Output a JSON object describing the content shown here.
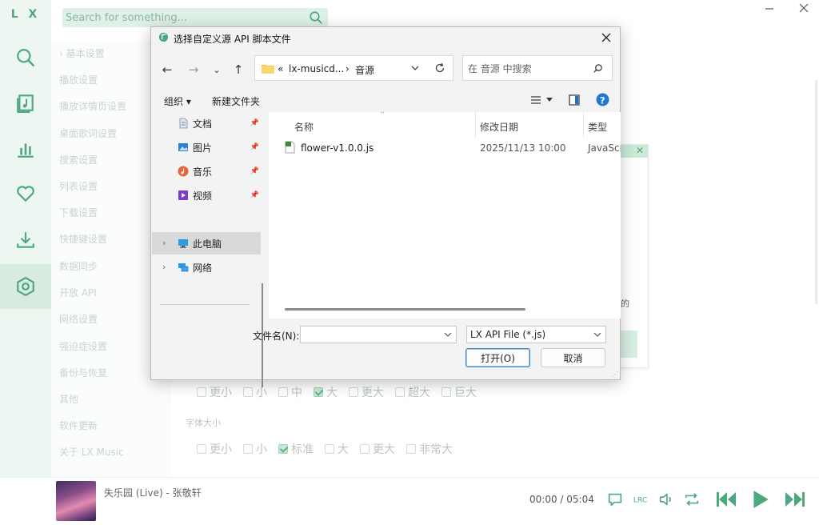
{
  "app": {
    "logo": "L X",
    "search_placeholder": "Search for something...",
    "accent": "#4ca87e"
  },
  "rail_icons": [
    "search-icon",
    "music-library-icon",
    "chart-icon",
    "heart-icon",
    "download-icon",
    "settings-icon"
  ],
  "settings_nav": [
    "› 基本设置",
    "播放设置",
    "播放详情页设置",
    "桌面歌词设置",
    "搜索设置",
    "列表设置",
    "下载设置",
    "快捷键设置",
    "数据同步",
    "开放 API",
    "网络设置",
    "强迫症设置",
    "备份与恢复",
    "其他",
    "软件更新",
    "关于 LX Music"
  ],
  "options_row1": [
    {
      "label": "更小",
      "checked": false
    },
    {
      "label": "小",
      "checked": false
    },
    {
      "label": "中",
      "checked": false
    },
    {
      "label": "大",
      "checked": true
    },
    {
      "label": "更大",
      "checked": false
    },
    {
      "label": "超大",
      "checked": false
    },
    {
      "label": "巨大",
      "checked": false
    }
  ],
  "font_size_label": "字体大小",
  "options_row2": [
    {
      "label": "更小",
      "checked": false
    },
    {
      "label": "小",
      "checked": false
    },
    {
      "label": "标准",
      "checked": true
    },
    {
      "label": "大",
      "checked": false
    },
    {
      "label": "更大",
      "checked": false
    },
    {
      "label": "非常大",
      "checked": false
    }
  ],
  "behind_popup": {
    "close": "✕",
    "text": "的"
  },
  "player": {
    "song": "失乐园 (Live) - 张敬轩",
    "time": "00:00 / 05:04"
  },
  "dialog": {
    "title": "选择自定义源 API 脚本文件",
    "close": "✕",
    "address": {
      "prefix": "«",
      "crumb1": "lx-musicd...",
      "sep": "›",
      "crumb2": "音源"
    },
    "search_placeholder": "在 音源 中搜索",
    "toolbar": {
      "organize": "组织 ▾",
      "new_folder": "新建文件夹"
    },
    "tree": [
      {
        "label": "文档",
        "icon": "document-icon"
      },
      {
        "label": "图片",
        "icon": "picture-icon"
      },
      {
        "label": "音乐",
        "icon": "music-icon"
      },
      {
        "label": "视频",
        "icon": "video-icon"
      },
      {
        "label": "此电脑",
        "icon": "computer-icon"
      },
      {
        "label": "网络",
        "icon": "network-icon"
      }
    ],
    "columns": {
      "name": "名称",
      "date": "修改日期",
      "type": "类型"
    },
    "files": [
      {
        "name": "flower-v1.0.0.js",
        "date": "2025/11/13 10:00",
        "type": "JavaScript"
      }
    ],
    "filename_label": "文件名(N):",
    "filename_value": "",
    "filter": "LX API File (*.js)",
    "open_button": "打开(O)",
    "cancel_button": "取消"
  }
}
